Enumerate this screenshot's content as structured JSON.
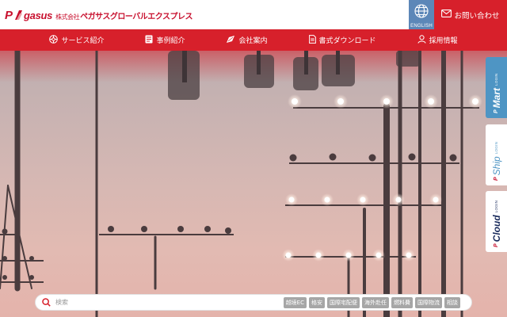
{
  "header": {
    "logo": {
      "p": "P",
      "brand": "gasus",
      "company_prefix": "株式会社",
      "company_name": "ペガサスグローバルエクスプレス"
    },
    "english_label": "ENGLISH",
    "contact_label": "お問い合わせ"
  },
  "nav": {
    "items": [
      {
        "label": "サービス紹介",
        "icon": "services-icon"
      },
      {
        "label": "事例紹介",
        "icon": "cases-icon"
      },
      {
        "label": "会社案内",
        "icon": "company-icon"
      },
      {
        "label": "書式ダウンロード",
        "icon": "download-icon"
      },
      {
        "label": "採用情報",
        "icon": "recruit-icon"
      }
    ]
  },
  "side_tabs": [
    {
      "p": "P",
      "brand": "Mart",
      "login": "LOGIN"
    },
    {
      "p": "P",
      "brand": "Ship",
      "login": "LOGIN"
    },
    {
      "p": "P",
      "brand": "Cloud",
      "login": "LOGIN"
    }
  ],
  "search": {
    "placeholder": "検索",
    "tags": [
      "越境EC",
      "格安",
      "国際宅配便",
      "海外赴任",
      "燃料費",
      "国際物流",
      "相談"
    ]
  },
  "colors": {
    "brand_red": "#d7202b",
    "english_blue": "#5c87b8",
    "mart_blue": "#4e95c4"
  }
}
